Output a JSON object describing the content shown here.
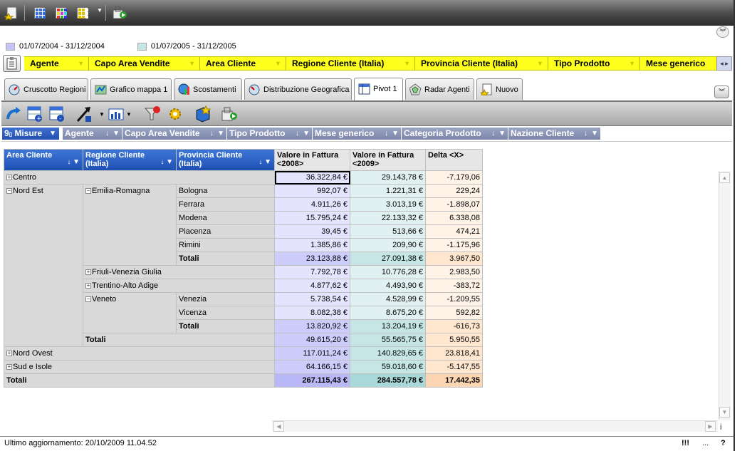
{
  "legend": [
    {
      "label": "01/07/2004 - 31/12/2004",
      "color": "#c4c4f6"
    },
    {
      "label": "01/07/2005 - 31/12/2005",
      "color": "#c6e6e6"
    }
  ],
  "dimensions": [
    "Agente",
    "Capo Area Vendite",
    "Area Cliente",
    "Regione Cliente (Italia)",
    "Provincia Cliente (Italia)",
    "Tipo Prodotto",
    "Mese generico"
  ],
  "tabs": [
    "Cruscotto Regioni",
    "Grafico mappa 1",
    "Scostamenti",
    "Distribuzione Geografica",
    "Pivot 1",
    "Radar Agenti",
    "Nuovo"
  ],
  "filter_fields": [
    "Misure",
    "Agente",
    "Capo Area Vendite",
    "Tipo Prodotto",
    "Mese generico",
    "Categoria Prodotto",
    "Nazione Cliente"
  ],
  "measures_prefix": "9",
  "headers": {
    "area": "Area Cliente",
    "regione": "Regione Cliente (Italia)",
    "provincia": "Provincia Cliente (Italia)",
    "v2008": "Valore in Fattura <2008>",
    "v2009": "Valore in Fattura <2009>",
    "delta": "Delta <X>"
  },
  "rows": {
    "centro": {
      "label": "Centro",
      "v1": "36.322,84 €",
      "v2": "29.143,78 €",
      "d": "-7.179,06"
    },
    "nord_est": "Nord Est",
    "emilia": "Emilia-Romagna",
    "bologna": {
      "label": "Bologna",
      "v1": "992,07 €",
      "v2": "1.221,31 €",
      "d": "229,24"
    },
    "ferrara": {
      "label": "Ferrara",
      "v1": "4.911,26 €",
      "v2": "3.013,19 €",
      "d": "-1.898,07"
    },
    "modena": {
      "label": "Modena",
      "v1": "15.795,24 €",
      "v2": "22.133,32 €",
      "d": "6.338,08"
    },
    "piacenza": {
      "label": "Piacenza",
      "v1": "39,45 €",
      "v2": "513,66 €",
      "d": "474,21"
    },
    "rimini": {
      "label": "Rimini",
      "v1": "1.385,86 €",
      "v2": "209,90 €",
      "d": "-1.175,96"
    },
    "emilia_tot": {
      "label": "Totali",
      "v1": "23.123,88 €",
      "v2": "27.091,38 €",
      "d": "3.967,50"
    },
    "friuli": {
      "label": "Friuli-Venezia Giulia",
      "v1": "7.792,78 €",
      "v2": "10.776,28 €",
      "d": "2.983,50"
    },
    "trentino": {
      "label": "Trentino-Alto Adige",
      "v1": "4.877,62 €",
      "v2": "4.493,90 €",
      "d": "-383,72"
    },
    "veneto": "Veneto",
    "venezia": {
      "label": "Venezia",
      "v1": "5.738,54 €",
      "v2": "4.528,99 €",
      "d": "-1.209,55"
    },
    "vicenza": {
      "label": "Vicenza",
      "v1": "8.082,38 €",
      "v2": "8.675,20 €",
      "d": "592,82"
    },
    "veneto_tot": {
      "label": "Totali",
      "v1": "13.820,92 €",
      "v2": "13.204,19 €",
      "d": "-616,73"
    },
    "nordest_tot": {
      "label": "Totali",
      "v1": "49.615,20 €",
      "v2": "55.565,75 €",
      "d": "5.950,55"
    },
    "nord_ovest": {
      "label": "Nord Ovest",
      "v1": "117.011,24 €",
      "v2": "140.829,65 €",
      "d": "23.818,41"
    },
    "sud": {
      "label": "Sud e Isole",
      "v1": "64.166,15 €",
      "v2": "59.018,60 €",
      "d": "-5.147,55"
    },
    "grand": {
      "label": "Totali",
      "v1": "267.115,43 €",
      "v2": "284.557,78 €",
      "d": "17.442,35"
    }
  },
  "status": {
    "last_update": "Ultimo aggiornamento: 20/10/2009 11.04.52",
    "flags": "!!!",
    "dots": "...",
    "help": "?"
  },
  "side_letter": "i"
}
